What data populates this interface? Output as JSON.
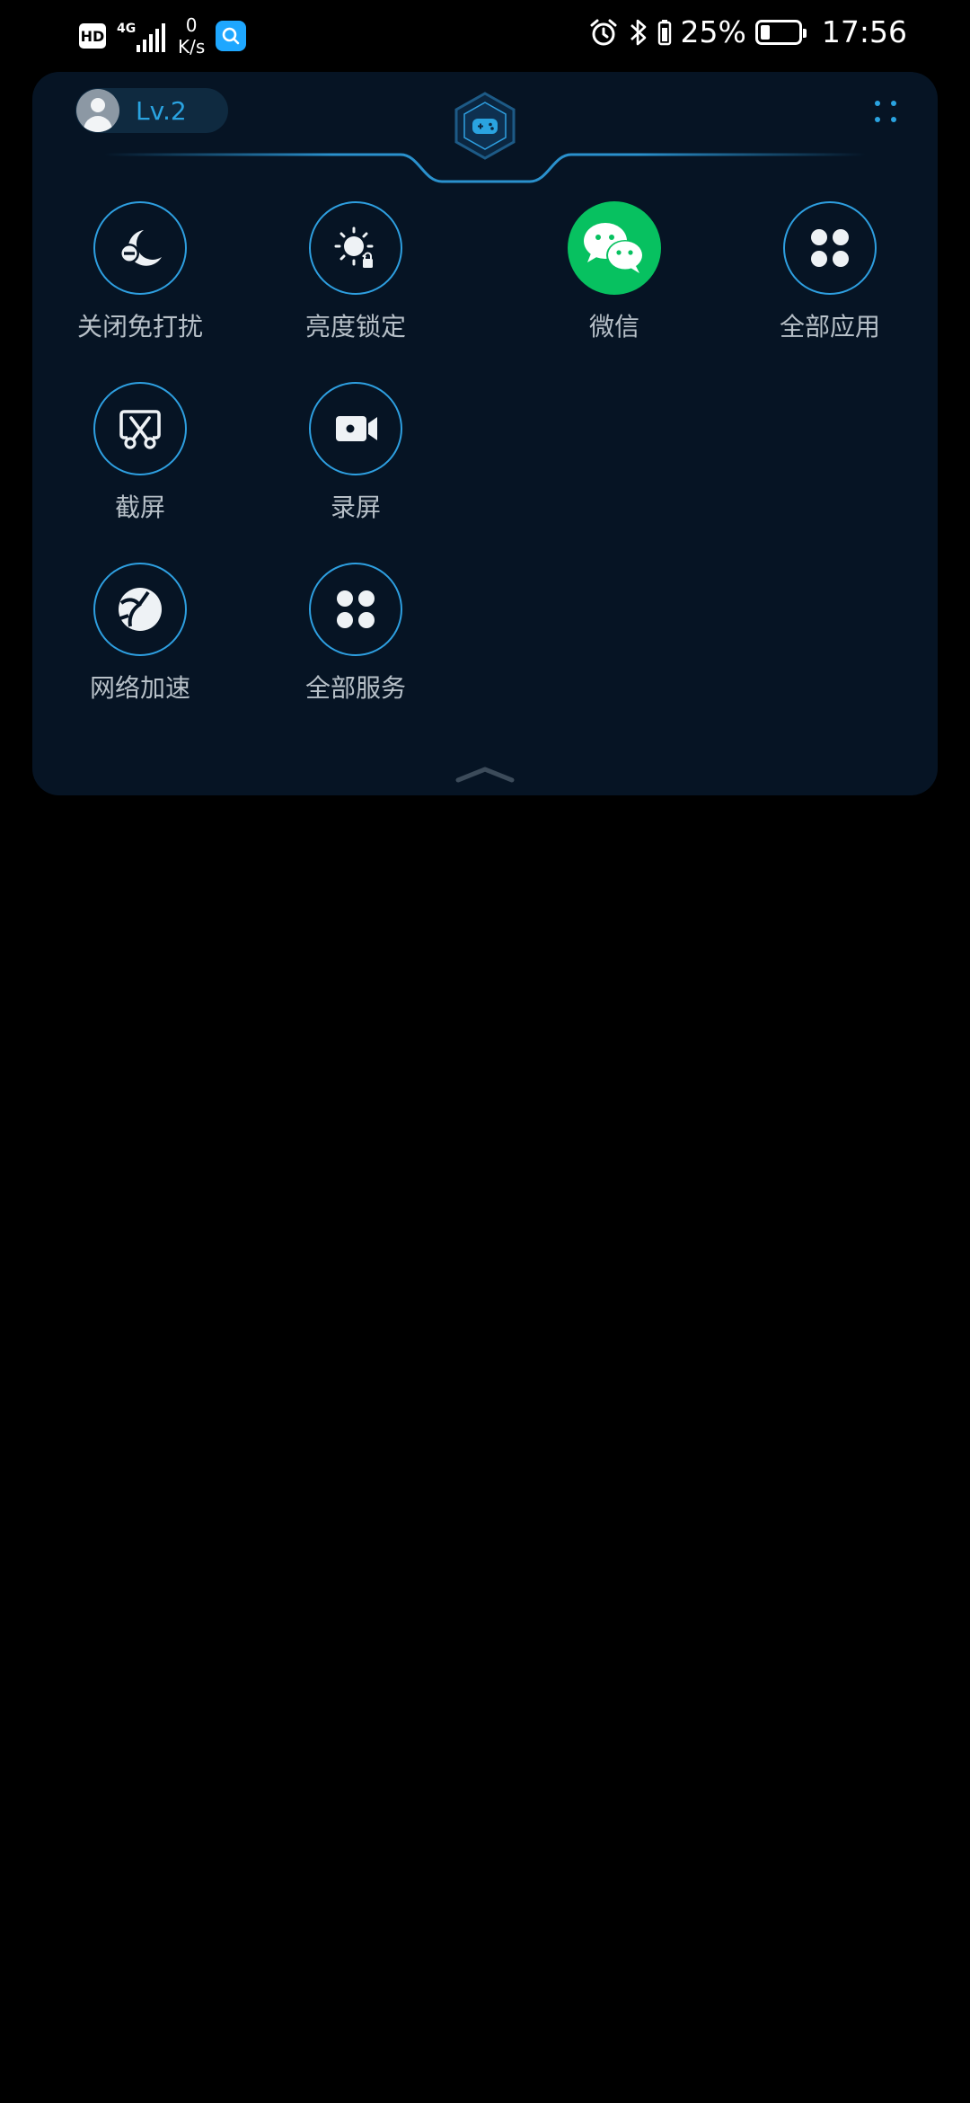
{
  "status_bar": {
    "hd_label": "HD",
    "network_type": "4G",
    "net_speed_value": "0",
    "net_speed_unit": "K/s",
    "battery_percent": "25%",
    "battery_level": 0.25,
    "time": "17:56"
  },
  "panel": {
    "level_label": "Lv.2",
    "items": [
      {
        "label": "关闭免打扰",
        "icon": "moon-dnd-off-icon"
      },
      {
        "label": "亮度锁定",
        "icon": "brightness-lock-icon"
      },
      {
        "label": "微信",
        "icon": "wechat-icon"
      },
      {
        "label": "全部应用",
        "icon": "all-apps-icon"
      },
      {
        "label": "截屏",
        "icon": "screenshot-scissors-icon"
      },
      {
        "label": "录屏",
        "icon": "screen-record-icon"
      },
      {
        "label": "网络加速",
        "icon": "network-boost-icon"
      },
      {
        "label": "全部服务",
        "icon": "all-services-icon"
      }
    ]
  },
  "colors": {
    "panel_bg": "#061424",
    "accent_blue": "#2e9fe0",
    "wechat_green": "#07c160",
    "label_gray": "#b7c0c8"
  }
}
